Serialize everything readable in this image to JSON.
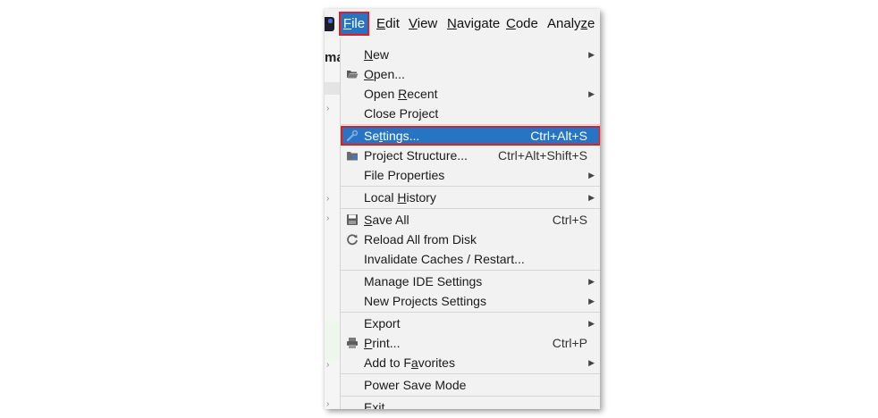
{
  "menubar": {
    "items": [
      {
        "pre": "",
        "mn": "F",
        "post": "ile"
      },
      {
        "pre": "",
        "mn": "E",
        "post": "dit"
      },
      {
        "pre": "",
        "mn": "V",
        "post": "iew"
      },
      {
        "pre": "",
        "mn": "N",
        "post": "avigate"
      },
      {
        "pre": "",
        "mn": "C",
        "post": "ode"
      },
      {
        "pre": "Analy",
        "mn": "z",
        "post": "e"
      }
    ]
  },
  "background": {
    "project_fragment": "ma"
  },
  "file_menu": {
    "items": [
      {
        "pre": "",
        "mn": "N",
        "post": "ew",
        "shortcut": "",
        "submenu": true,
        "icon": ""
      },
      {
        "pre": "",
        "mn": "O",
        "post": "pen...",
        "shortcut": "",
        "submenu": false,
        "icon": "folder-open-icon"
      },
      {
        "pre": "Open ",
        "mn": "R",
        "post": "ecent",
        "shortcut": "",
        "submenu": true,
        "icon": ""
      },
      {
        "pre": "Close Project",
        "mn": "",
        "post": "",
        "shortcut": "",
        "submenu": false,
        "icon": ""
      },
      {
        "pre": "Se",
        "mn": "t",
        "post": "tings...",
        "shortcut": "Ctrl+Alt+S",
        "submenu": false,
        "icon": "wrench-icon"
      },
      {
        "pre": "Project Structure...",
        "mn": "",
        "post": "",
        "shortcut": "Ctrl+Alt+Shift+S",
        "submenu": false,
        "icon": "project-structure-icon"
      },
      {
        "pre": "File Properties",
        "mn": "",
        "post": "",
        "shortcut": "",
        "submenu": true,
        "icon": ""
      },
      {
        "pre": "Local ",
        "mn": "H",
        "post": "istory",
        "shortcut": "",
        "submenu": true,
        "icon": ""
      },
      {
        "pre": "",
        "mn": "S",
        "post": "ave All",
        "shortcut": "Ctrl+S",
        "submenu": false,
        "icon": "save-icon"
      },
      {
        "pre": "Reload All from Disk",
        "mn": "",
        "post": "",
        "shortcut": "",
        "submenu": false,
        "icon": "reload-icon"
      },
      {
        "pre": "Invalidate Caches / Restart...",
        "mn": "",
        "post": "",
        "shortcut": "",
        "submenu": false,
        "icon": ""
      },
      {
        "pre": "Manage IDE Settings",
        "mn": "",
        "post": "",
        "shortcut": "",
        "submenu": true,
        "icon": ""
      },
      {
        "pre": "New Projects Settings",
        "mn": "",
        "post": "",
        "shortcut": "",
        "submenu": true,
        "icon": ""
      },
      {
        "pre": "Export",
        "mn": "",
        "post": "",
        "shortcut": "",
        "submenu": true,
        "icon": ""
      },
      {
        "pre": "",
        "mn": "P",
        "post": "rint...",
        "shortcut": "Ctrl+P",
        "submenu": false,
        "icon": "printer-icon"
      },
      {
        "pre": "Add to F",
        "mn": "a",
        "post": "vorites",
        "shortcut": "",
        "submenu": true,
        "icon": ""
      },
      {
        "pre": "Power Save Mode",
        "mn": "",
        "post": "",
        "shortcut": "",
        "submenu": false,
        "icon": ""
      },
      {
        "pre": "E",
        "mn": "x",
        "post": "it",
        "shortcut": "",
        "submenu": false,
        "icon": ""
      }
    ],
    "selected_index": 4
  },
  "colors": {
    "selection": "#2675c4",
    "highlight_border": "#e01c24",
    "menu_bg": "#f2f2f2",
    "separator": "#d6d6d6"
  }
}
